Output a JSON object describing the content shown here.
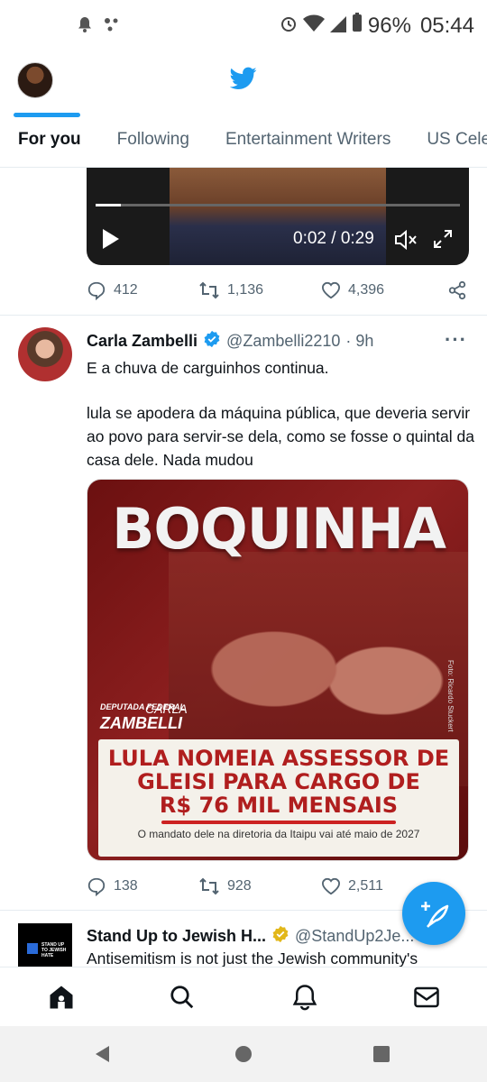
{
  "status_bar": {
    "battery": "96%",
    "time": "05:44"
  },
  "header": {
    "tabs": [
      "For you",
      "Following",
      "Entertainment Writers",
      "US Cele"
    ]
  },
  "video": {
    "time": "0:02 / 0:29",
    "progress": 0.07
  },
  "video_tweet_actions": {
    "replies": "412",
    "retweets": "1,136",
    "likes": "4,396"
  },
  "tweet": {
    "name": "Carla Zambelli",
    "handle": "@Zambelli2210",
    "time": "· 9h",
    "text_1": "E a chuva de carguinhos continua.",
    "text_2": "lula se apodera da máquina pública, que deveria servir ao povo para servir-se dela, como se fosse o quintal da casa dele. Nada mudou",
    "media": {
      "title": "BOQUINHA",
      "deputy_line_1": "DEPUTADA FEDERAL",
      "deputy_line_2": "CARLA",
      "deputy_line_3": "ZAMBELLI",
      "photo_credit": "Foto: Ricardo Stuckert",
      "headline_1": "LULA NOMEIA ASSESSOR DE",
      "headline_2": "GLEISI PARA CARGO DE",
      "headline_3": "R$ 76 MIL MENSAIS",
      "subline": "O mandato dele na diretoria da Itaipu vai até maio de 2027"
    },
    "actions": {
      "replies": "138",
      "retweets": "928",
      "likes": "2,511"
    }
  },
  "next_tweet": {
    "name": "Stand Up to Jewish H...",
    "handle": "@StandUp2Je...",
    "text": "Antisemitism is not just the Jewish community's",
    "avatar_text": "STAND UP TO JEWISH HATE"
  },
  "colors": {
    "accent": "#1d9bf0",
    "text": "#0f1419",
    "muted": "#536471",
    "verified_gold": "#e2b719"
  }
}
